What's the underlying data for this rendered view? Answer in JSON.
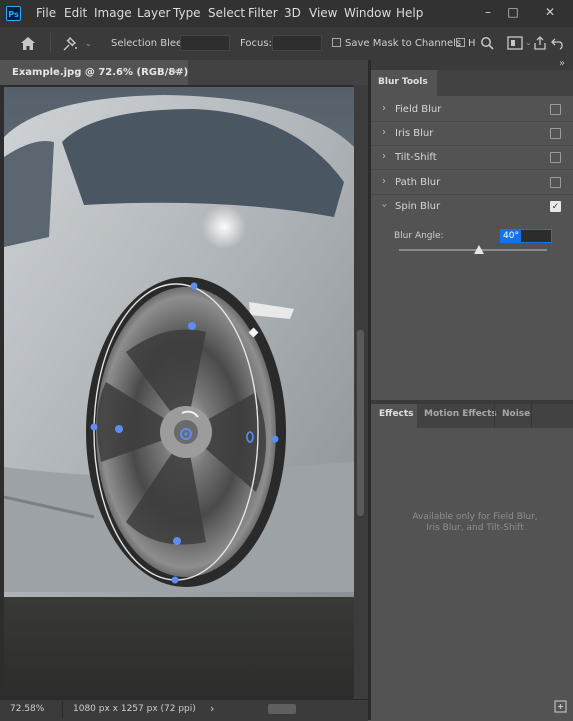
{
  "app": {
    "logo": "Ps"
  },
  "menu": [
    "File",
    "Edit",
    "Image",
    "Layer",
    "Type",
    "Select",
    "Filter",
    "3D",
    "View",
    "Window",
    "Help"
  ],
  "window_controls": {
    "minimize": "–",
    "restore": "□",
    "close": "✕"
  },
  "options_bar": {
    "selection_bleed_label": "Selection Bleed:",
    "focus_label": "Focus:",
    "save_mask_label": "Save Mask to Channels",
    "h_label": "H"
  },
  "document": {
    "tab_title": "Example.jpg @ 72.6% (RGB/8#)",
    "close": "×"
  },
  "panels": {
    "collapse_glyph": "»",
    "blur_tools": {
      "title": "Blur Tools",
      "items": [
        {
          "label": "Field Blur",
          "checked": false
        },
        {
          "label": "Iris Blur",
          "checked": false
        },
        {
          "label": "Tilt-Shift",
          "checked": false
        },
        {
          "label": "Path Blur",
          "checked": false
        },
        {
          "label": "Spin Blur",
          "checked": true
        }
      ],
      "blur_angle_label": "Blur Angle:",
      "blur_angle_value": "40°",
      "blur_angle_slider_level": 0.54
    },
    "effects": {
      "tabs": [
        "Effects",
        "Motion Effects",
        "Noise"
      ],
      "note_line1": "Available only for Field Blur,",
      "note_line2": "Iris Blur, and Tilt-Shift"
    }
  },
  "status": {
    "zoom": "72.58%",
    "doc_size": "1080 px x 1257 px (72 ppi)",
    "arrow": "›"
  },
  "colors": {
    "accent": "#1473e6",
    "pin": "#5b8ef0",
    "app_bg": "#535353"
  }
}
